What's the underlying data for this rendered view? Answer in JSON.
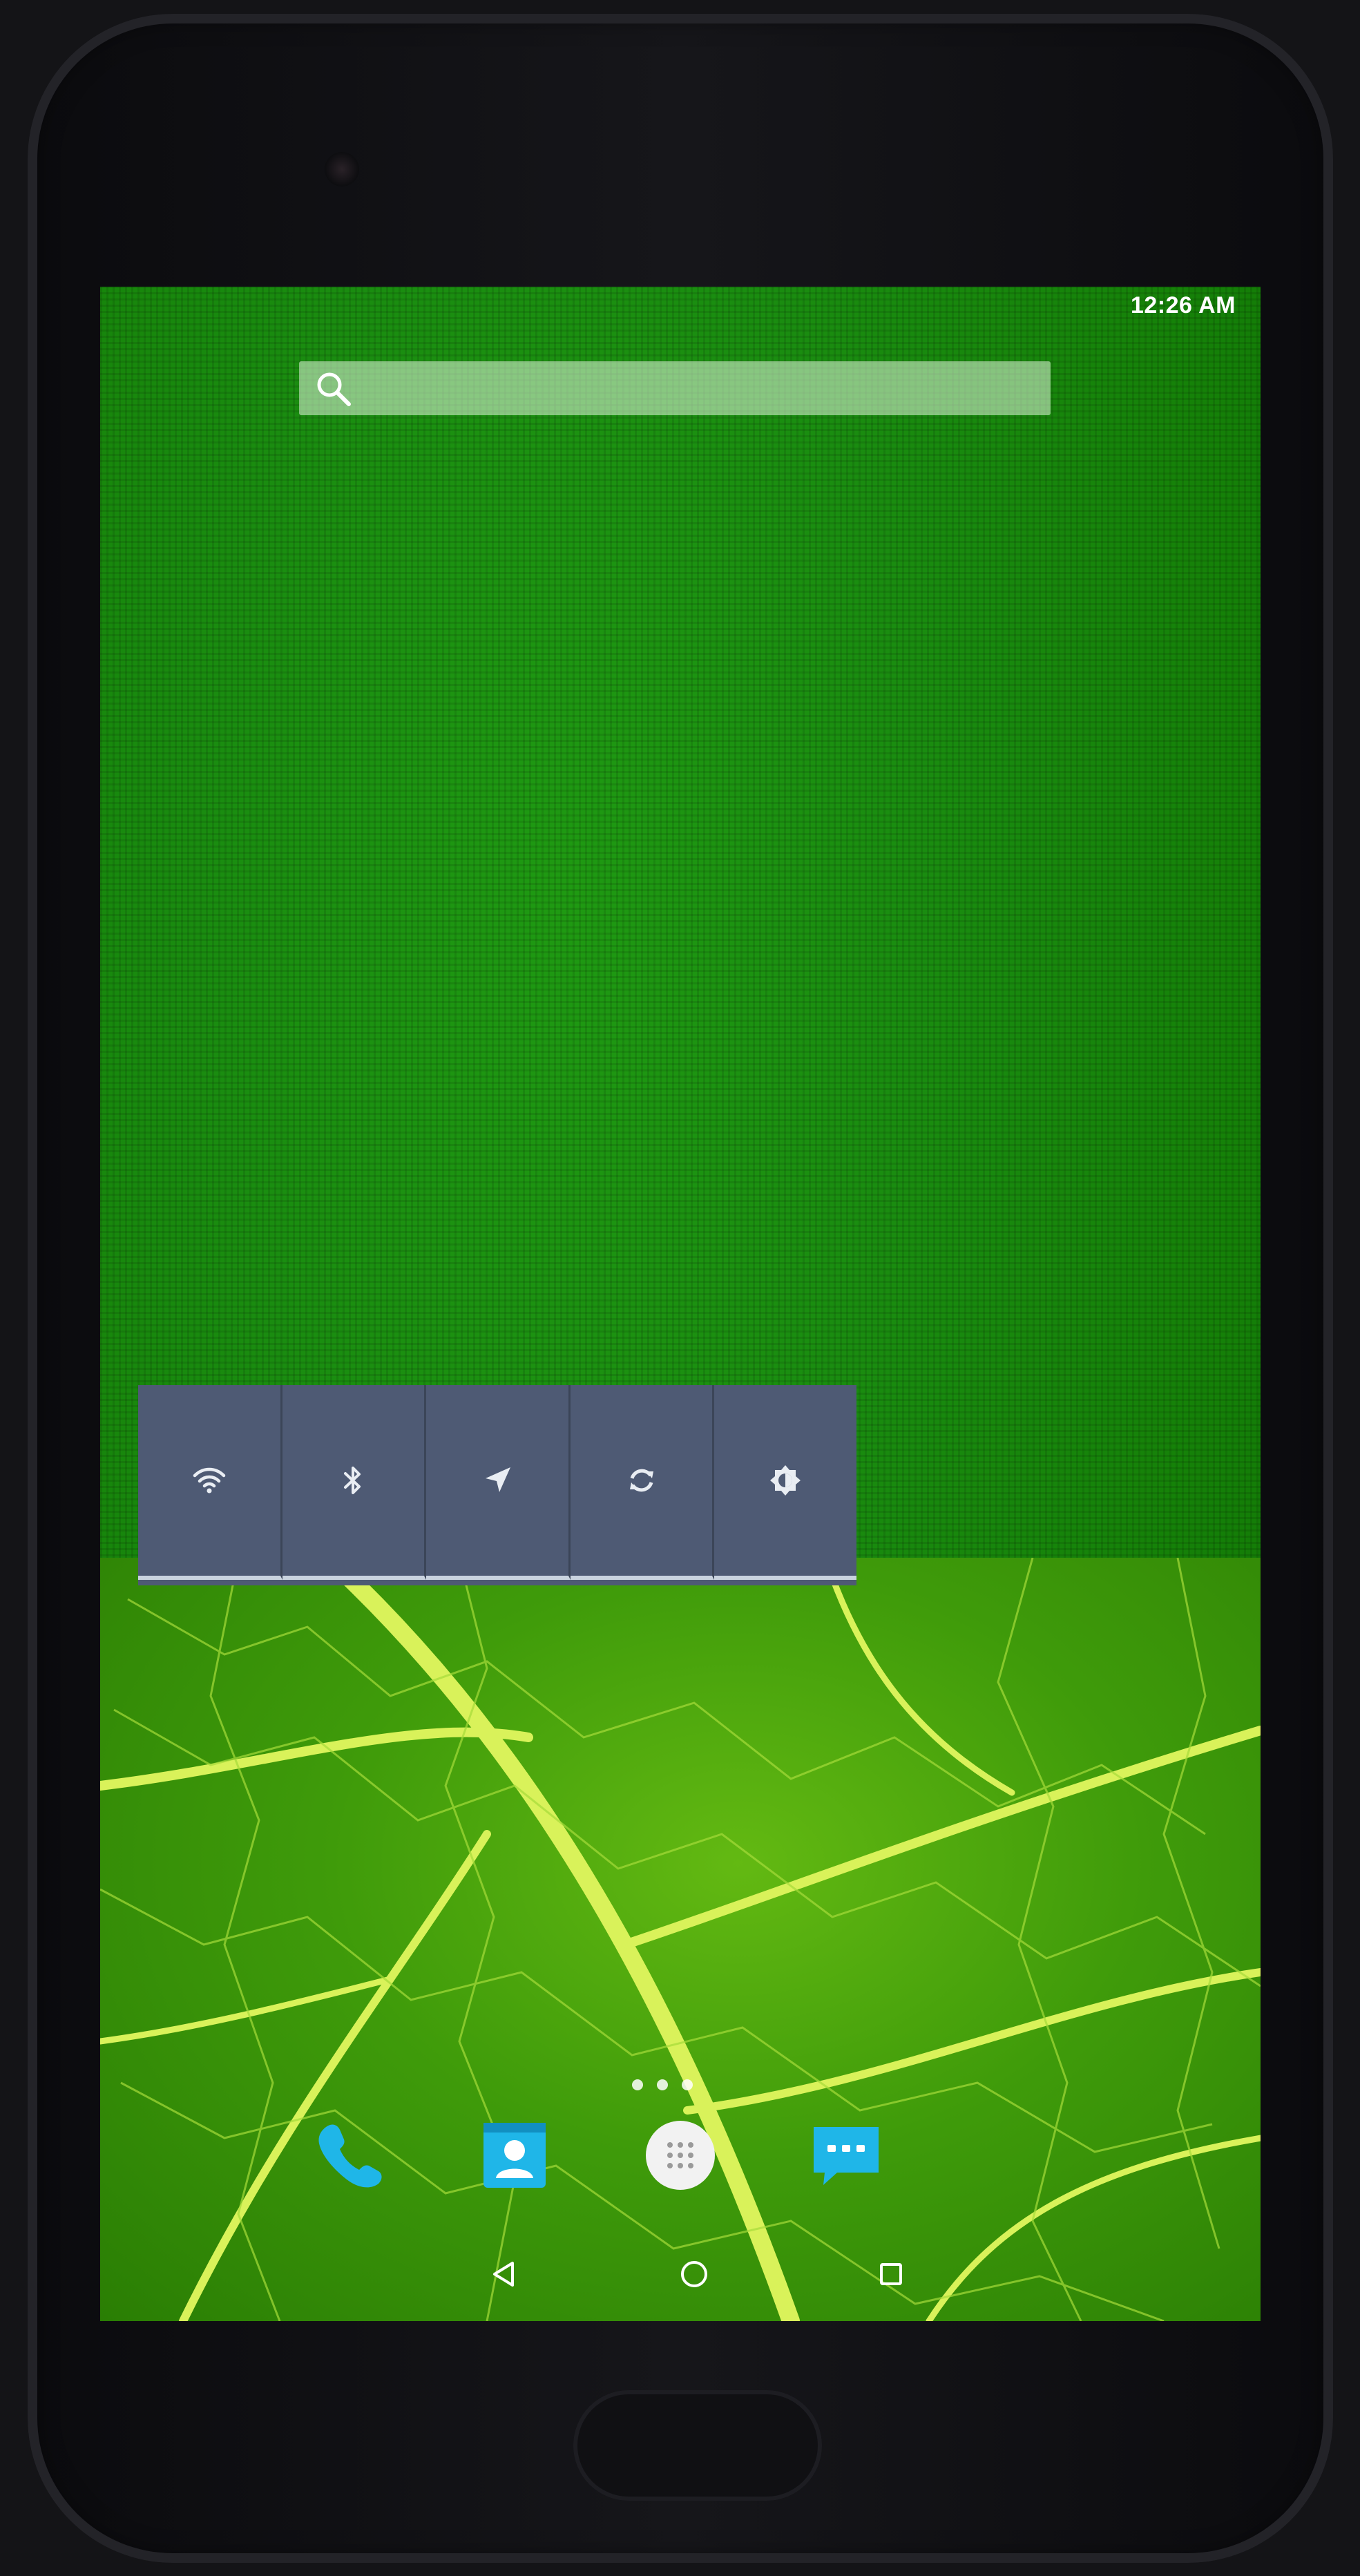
{
  "status_bar": {
    "time": "12:26 AM"
  },
  "search_bar": {
    "icon": "search-icon"
  },
  "quick_settings": {
    "tiles": [
      {
        "name": "wifi",
        "icon": "wifi-icon"
      },
      {
        "name": "bluetooth",
        "icon": "bluetooth-icon"
      },
      {
        "name": "location",
        "icon": "location-icon"
      },
      {
        "name": "sync",
        "icon": "sync-icon"
      },
      {
        "name": "brightness",
        "icon": "brightness-icon"
      }
    ]
  },
  "dock": {
    "apps": [
      {
        "name": "phone",
        "icon": "phone-icon"
      },
      {
        "name": "contacts",
        "icon": "contacts-icon"
      },
      {
        "name": "app-drawer",
        "icon": "app-drawer-icon"
      },
      {
        "name": "messaging",
        "icon": "messaging-icon"
      }
    ]
  },
  "navigation": {
    "buttons": [
      "back",
      "home",
      "recents"
    ]
  },
  "colors": {
    "wallpaper_green": "#1a8d10",
    "leaf_green": "#3f9b0a",
    "widget_bg": "#4e5a74",
    "widget_accent": "#c9d3df",
    "app_icon_blue": "#1fb6e8"
  }
}
